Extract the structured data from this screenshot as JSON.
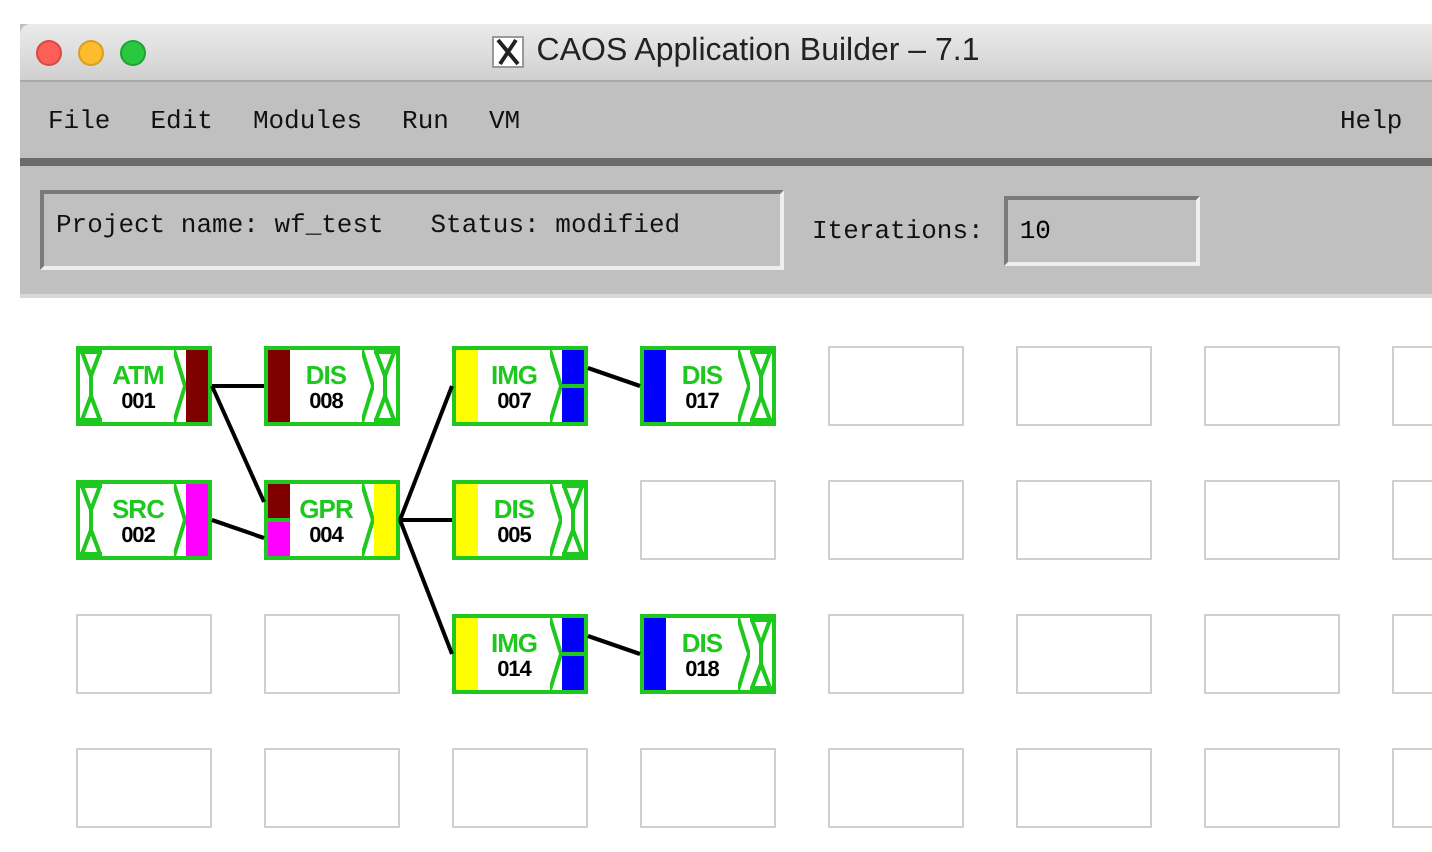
{
  "window": {
    "title": "CAOS Application Builder – 7.1"
  },
  "menu": {
    "items": [
      {
        "label": "File"
      },
      {
        "label": "Edit"
      },
      {
        "label": "Modules"
      },
      {
        "label": "Run"
      },
      {
        "label": "VM"
      }
    ],
    "help": "Help"
  },
  "project": {
    "status_text": "Project name: wf_test   Status: modified"
  },
  "iterations": {
    "label": "Iterations:",
    "value": "10"
  },
  "grid": {
    "rows": [
      [
        {
          "kind": "module",
          "name": "ATM",
          "number": "001",
          "outputs": [
            {
              "color": "#800000"
            }
          ]
        },
        {
          "kind": "module",
          "name": "DIS",
          "number": "008",
          "inputs": [
            {
              "color": "#800000"
            }
          ]
        },
        {
          "kind": "module",
          "name": "IMG",
          "number": "007",
          "inputs": [
            {
              "color": "#ffff00"
            }
          ],
          "outputs": [
            {
              "color": "#0000ff"
            },
            {
              "color": "#0000ff"
            }
          ]
        },
        {
          "kind": "module",
          "name": "DIS",
          "number": "017",
          "inputs": [
            {
              "color": "#0000ff"
            }
          ]
        },
        {
          "kind": "empty"
        },
        {
          "kind": "empty"
        },
        {
          "kind": "empty"
        },
        {
          "kind": "empty"
        }
      ],
      [
        {
          "kind": "module",
          "name": "SRC",
          "number": "002",
          "outputs": [
            {
              "color": "#ff00ff"
            }
          ]
        },
        {
          "kind": "module",
          "name": "GPR",
          "number": "004",
          "inputs": [
            {
              "color": "#800000"
            },
            {
              "color": "#ff00ff"
            }
          ],
          "outputs": [
            {
              "color": "#ffff00"
            }
          ]
        },
        {
          "kind": "module",
          "name": "DIS",
          "number": "005",
          "inputs": [
            {
              "color": "#ffff00"
            }
          ]
        },
        {
          "kind": "empty"
        },
        {
          "kind": "empty"
        },
        {
          "kind": "empty"
        },
        {
          "kind": "empty"
        },
        {
          "kind": "empty"
        }
      ],
      [
        {
          "kind": "empty"
        },
        {
          "kind": "empty"
        },
        {
          "kind": "module",
          "name": "IMG",
          "number": "014",
          "inputs": [
            {
              "color": "#ffff00"
            }
          ],
          "outputs": [
            {
              "color": "#0000ff"
            },
            {
              "color": "#0000ff"
            }
          ]
        },
        {
          "kind": "module",
          "name": "DIS",
          "number": "018",
          "inputs": [
            {
              "color": "#0000ff"
            }
          ]
        },
        {
          "kind": "empty"
        },
        {
          "kind": "empty"
        },
        {
          "kind": "empty"
        },
        {
          "kind": "empty"
        }
      ],
      [
        {
          "kind": "empty"
        },
        {
          "kind": "empty"
        },
        {
          "kind": "empty"
        },
        {
          "kind": "empty"
        },
        {
          "kind": "empty"
        },
        {
          "kind": "empty"
        },
        {
          "kind": "empty"
        },
        {
          "kind": "empty"
        }
      ]
    ]
  }
}
